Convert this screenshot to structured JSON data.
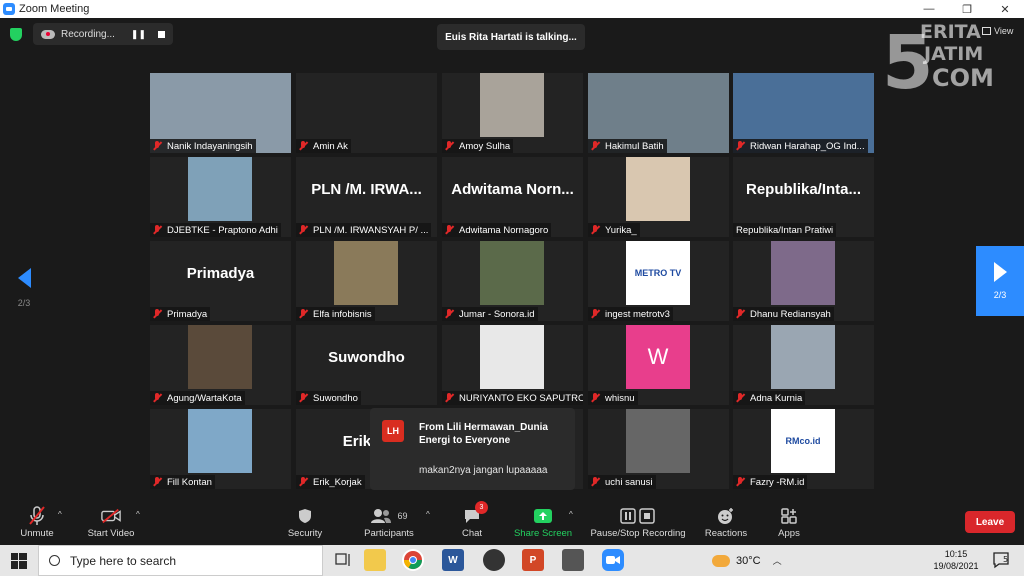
{
  "window": {
    "title": "Zoom Meeting"
  },
  "window_controls": {
    "minimize": "—",
    "maximize": "❐",
    "close": "✕"
  },
  "top_bar": {
    "recording_label": "Recording...",
    "pause_glyph": "❚❚",
    "talking_banner": "Euis Rita Hartati is talking...",
    "view_label": "View"
  },
  "watermark": {
    "line1": "ERITA",
    "line2": "JATIM",
    "line3": "COM",
    "digit": "5"
  },
  "pager": {
    "left": "2/3",
    "right": "2/3"
  },
  "participants": [
    {
      "name": "Nanik Indayaningsih",
      "display": "",
      "avatar": "photo",
      "color": "#8a9aa8"
    },
    {
      "name": "Amin Ak",
      "display": "",
      "avatar": "none",
      "color": "#232323"
    },
    {
      "name": "Amoy Sulha",
      "display": "",
      "avatar": "photo",
      "color": "#a9a39a"
    },
    {
      "name": "Hakimul Batih",
      "display": "",
      "avatar": "photo",
      "color": "#6f7f8a"
    },
    {
      "name": "Ridwan Harahap_OG Ind...",
      "display": "",
      "avatar": "photo",
      "color": "#4a6f98"
    },
    {
      "name": "DJEBTKE - Praptono Adhi",
      "display": "",
      "avatar": "photo",
      "color": "#7fa1b8"
    },
    {
      "name": "PLN /M. IRWANSYAH P/ ...",
      "display": "PLN /M. IRWA...",
      "avatar": "text",
      "color": "#232323"
    },
    {
      "name": "Adwitama Nornagoro",
      "display": "Adwitama Norn...",
      "avatar": "text",
      "color": "#232323"
    },
    {
      "name": "Yurika_",
      "display": "",
      "avatar": "photo",
      "color": "#d9c7b0"
    },
    {
      "name": "Republika/Intan Pratiwi",
      "display": "Republika/Inta...",
      "avatar": "text",
      "color": "#232323"
    },
    {
      "name": "Primadya",
      "display": "Primadya",
      "avatar": "text",
      "color": "#232323"
    },
    {
      "name": "Elfa infobisnis",
      "display": "",
      "avatar": "photo",
      "color": "#8a7a5a"
    },
    {
      "name": "Jumar - Sonora.id",
      "display": "",
      "avatar": "photo",
      "color": "#5b6a4a"
    },
    {
      "name": "ingest metrotv3",
      "display": "",
      "avatar": "logo",
      "color": "#ffffff",
      "logo_text": "METRO TV"
    },
    {
      "name": "Dhanu Rediansyah",
      "display": "",
      "avatar": "photo",
      "color": "#7e6a8a"
    },
    {
      "name": "Agung/WartaKota",
      "display": "",
      "avatar": "photo",
      "color": "#5a4a3a"
    },
    {
      "name": "Suwondho",
      "display": "Suwondho",
      "avatar": "text",
      "color": "#232323"
    },
    {
      "name": "NURIYANTO EKO SAPUTRO",
      "display": "",
      "avatar": "photo",
      "color": "#e8e8e8"
    },
    {
      "name": "whisnu",
      "display": "",
      "avatar": "letter",
      "color": "#e83e8c",
      "letter": "W"
    },
    {
      "name": "Adna Kurnia",
      "display": "",
      "avatar": "photo",
      "color": "#9aa6b2"
    },
    {
      "name": "Fill Kontan",
      "display": "",
      "avatar": "photo",
      "color": "#7fa8c8"
    },
    {
      "name": "Erik_Korjak",
      "display": "Erik_K",
      "avatar": "text",
      "color": "#232323"
    },
    {
      "name": "",
      "display": "",
      "avatar": "none",
      "color": "#232323"
    },
    {
      "name": "uchi sanusi",
      "display": "",
      "avatar": "photo",
      "color": "#666666"
    },
    {
      "name": "Fazry -RM.id",
      "display": "",
      "avatar": "logo",
      "color": "#ffffff",
      "logo_text": "RMco.id"
    }
  ],
  "chat_notification": {
    "initials": "LH",
    "from": "From Lili Hermawan_Dunia Energi to Everyone",
    "message": "makan2nya jangan lupaaaaa"
  },
  "toolbar": {
    "unmute": "Unmute",
    "start_video": "Start Video",
    "security": "Security",
    "participants": "Participants",
    "participants_count": "69",
    "chat": "Chat",
    "chat_badge": "3",
    "share_screen": "Share Screen",
    "pause_recording": "Pause/Stop Recording",
    "reactions": "Reactions",
    "apps": "Apps",
    "leave": "Leave",
    "caret": "^"
  },
  "taskbar": {
    "search_placeholder": "Type here to search",
    "temperature": "30°C",
    "time": "10:15",
    "date": "19/08/2021",
    "notification_count": "5"
  },
  "colors": {
    "accent": "#2d8cff",
    "leave": "#d9272b",
    "share": "#23d160",
    "muted": "#e02828"
  }
}
